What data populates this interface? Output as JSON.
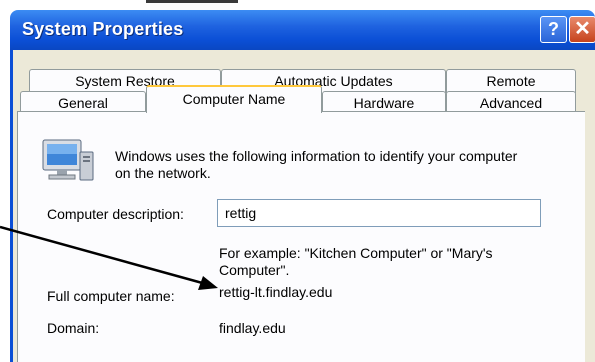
{
  "window": {
    "title": "System Properties",
    "help_glyph": "?",
    "close_glyph": "✕"
  },
  "tabs": {
    "row1": [
      "System Restore",
      "Automatic Updates",
      "Remote"
    ],
    "row2": [
      "General",
      "Computer Name",
      "Hardware",
      "Advanced"
    ],
    "selected": "Computer Name"
  },
  "panel": {
    "intro_line1": "Windows uses the following information to identify your computer",
    "intro_line2": "on the network.",
    "description_label": "Computer description:",
    "description_value": "rettig",
    "example_line1": "For example: \"Kitchen Computer\" or \"Mary's",
    "example_line2": "Computer\".",
    "fullname_label": "Full computer name:",
    "fullname_value": "rettig-lt.findlay.edu",
    "domain_label": "Domain:",
    "domain_value": "findlay.edu"
  },
  "icons": [
    "help-icon",
    "close-icon",
    "computer-network-icon",
    "annotation-arrow"
  ],
  "colors": {
    "titlebar": "#0b4fd6",
    "dialog_bg": "#ece9d8",
    "tab_highlight": "#ffc83c",
    "close_button": "#c6431d"
  }
}
